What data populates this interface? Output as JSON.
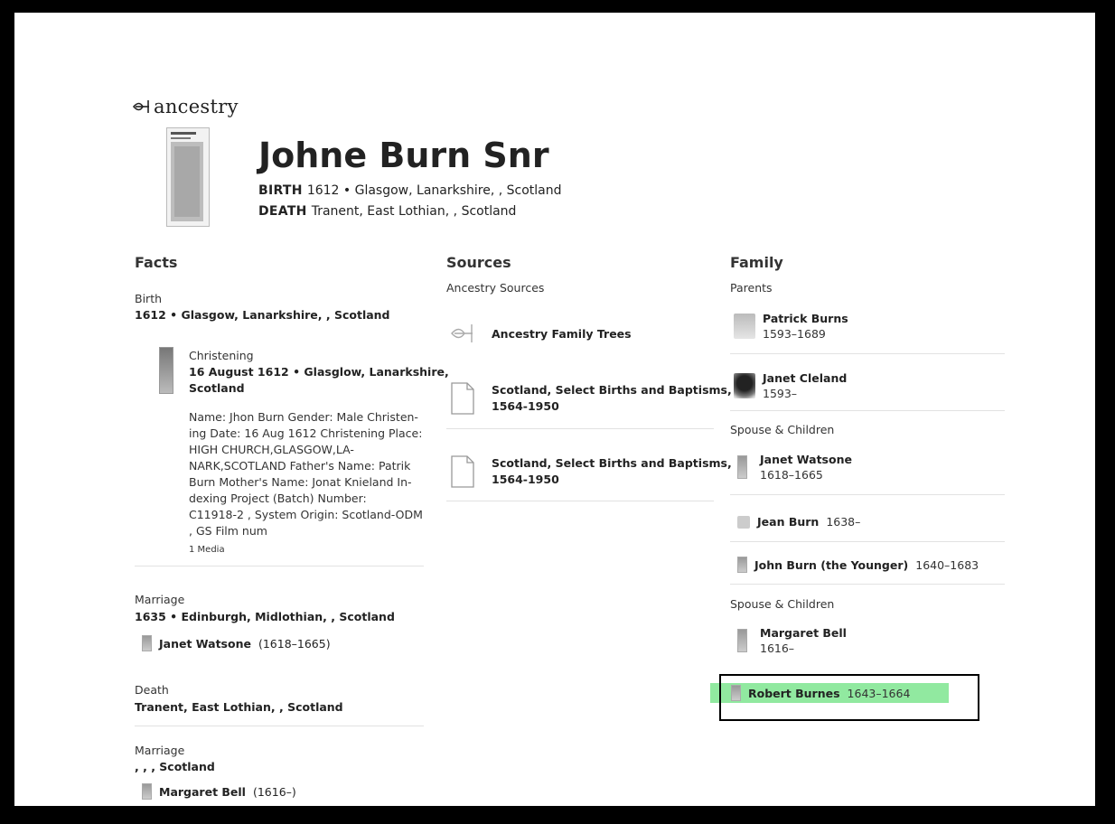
{
  "brand": {
    "name": "ancestry",
    "colors": {
      "highlight": "#7ee58f"
    }
  },
  "person": {
    "name": "Johne Burn Snr",
    "birth_label": "BIRTH",
    "birth_value": "1612 • Glasgow, Lanarkshire, , Scotland",
    "death_label": "DEATH",
    "death_value": "Tranent, East Lothian, , Scotland"
  },
  "facts": {
    "title": "Facts",
    "birth": {
      "heading": "Birth",
      "value": "1612 • Glasgow, Lanarkshire, , Scotland"
    },
    "christening": {
      "heading": "Christening",
      "value_line1": "16 August 1612 • Glasglow, Lanarkshire,",
      "value_line2": "Scotland",
      "desc_lines": [
        "Name: Jhon Burn Gender: Male Christen-",
        "ing Date: 16 Aug 1612 Christening Place:",
        "HIGH CHURCH,GLASGOW,LA-",
        "NARK,SCOTLAND Father's Name: Patrik",
        "Burn Mother's Name: Jonat Knieland In-",
        "dexing Project (Batch) Number:",
        "C11918-2 , System Origin: Scotland-ODM",
        ", GS Film num"
      ],
      "media": "1 Media"
    },
    "marriage1": {
      "heading": "Marriage",
      "value": "1635 • Edinburgh, Midlothian, , Scotland",
      "spouse": "Janet Watsone",
      "spouse_years": "(1618–1665)"
    },
    "death": {
      "heading": "Death",
      "value": "Tranent, East Lothian, , Scotland"
    },
    "marriage2": {
      "heading": "Marriage",
      "value": ", , , Scotland",
      "spouse": "Margaret Bell",
      "spouse_years": "(1616–)"
    }
  },
  "sources": {
    "title": "Sources",
    "subhead": "Ancestry Sources",
    "items": [
      {
        "label": "Ancestry Family Trees",
        "icon": "ancestry-leaf-icon"
      },
      {
        "label_line1": "Scotland, Select Births and Baptisms,",
        "label_line2": "1564-1950",
        "icon": "document-icon"
      },
      {
        "label_line1": "Scotland, Select Births and Baptisms,",
        "label_line2": "1564-1950",
        "icon": "document-icon"
      }
    ]
  },
  "family": {
    "title": "Family",
    "parents_heading": "Parents",
    "parents": [
      {
        "name": "Patrick Burns",
        "years": "1593–1689"
      },
      {
        "name": "Janet Cleland",
        "years": "1593–"
      }
    ],
    "spouse1_heading": "Spouse & Children",
    "spouse1": {
      "name": "Janet Watsone",
      "years": "1618–1665"
    },
    "children1": [
      {
        "name": "Jean Burn",
        "years": "1638–"
      },
      {
        "name": "John Burn (the Younger)",
        "years": "1640–1683"
      }
    ],
    "spouse2_heading": "Spouse & Children",
    "spouse2": {
      "name": "Margaret Bell",
      "years": "1616–"
    },
    "children2": [
      {
        "name": "Robert Burnes",
        "years": "1643–1664"
      }
    ]
  }
}
